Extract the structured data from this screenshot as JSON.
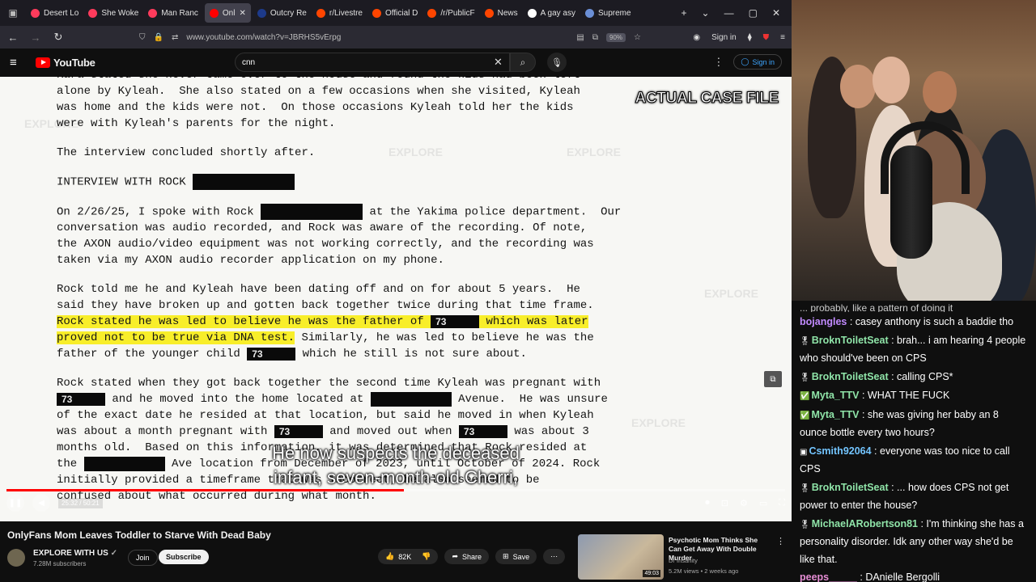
{
  "browser": {
    "tabs": [
      {
        "label": "Desert Lo",
        "color": "#ff3b5c",
        "active": false
      },
      {
        "label": "She Woke",
        "color": "#ff3b5c",
        "active": false
      },
      {
        "label": "Man Ranc",
        "color": "#ff3b5c",
        "active": false
      },
      {
        "label": "Onl",
        "color": "#ff0000",
        "active": true
      },
      {
        "label": "Outcry Re",
        "color": "#1d3a8a",
        "active": false
      },
      {
        "label": "r/Livestre",
        "color": "#ff4500",
        "active": false
      },
      {
        "label": "Official D",
        "color": "#ff4500",
        "active": false
      },
      {
        "label": "/r/PublicF",
        "color": "#ff4500",
        "active": false
      },
      {
        "label": "News",
        "color": "#ff4500",
        "active": false
      },
      {
        "label": "A gay asy",
        "color": "#ffffff",
        "active": false
      },
      {
        "label": "Supreme",
        "color": "#6b8fd6",
        "active": false
      }
    ],
    "url": "www.youtube.com/watch?v=JBRHS5vErpg",
    "zoom": "90%",
    "signin": "Sign in",
    "badge_count": "300"
  },
  "youtube": {
    "logo_text": "YouTube",
    "search_value": "cnn",
    "signin": "Sign in"
  },
  "video": {
    "overlay_label": "ACTUAL CASE FILE",
    "doc": {
      "p0": "Kara stated she never came over to the house and found the kids had been left",
      "p1": "alone by Kyleah.  She also stated on a few occasions when she visited, Kyleah",
      "p2": "was home and the kids were not.  On those occasions Kyleah told her the kids",
      "p3": "were with Kyleah's parents for the night.",
      "p4": "The interview concluded shortly after.",
      "p5": "INTERVIEW WITH ROCK",
      "p6a": "On 2/26/25, I spoke with Rock",
      "p6b": "at the Yakima police department.  Our",
      "p7": "conversation was audio recorded, and Rock was aware of the recording. Of note,",
      "p8": "the AXON audio/video equipment was not working correctly, and the recording was",
      "p9": "taken via my AXON audio recorder application on my phone.",
      "p10": "Rock told me he and Kyleah have been dating off and on for about 5 years.  He",
      "p11": "said they have broken up and gotten back together twice during that time frame.",
      "p12a": "Rock stated he was led to believe he was the father of",
      "p12b": "which was later",
      "p13a": "proved not to be true via DNA test.",
      "p13b": " Similarly, he was led to believe he was the",
      "p14a": "father of the younger child",
      "p14b": "which he still is not sure about.",
      "p15": "Rock stated when they got back together the second time Kyleah was pregnant with",
      "p16a": "and he moved into the home located at",
      "p16b": "Avenue.  He was unsure",
      "p17": "of the exact date he resided at that location, but said he moved in when Kyleah",
      "p18a": "was about a month pregnant with",
      "p18b": "and moved out when",
      "p18c": "was about 3",
      "p19": "months old.  Based on this information, it was determined that Rock resided at",
      "p20a": "the",
      "p20b": "Ave location from December of 2023, until October of 2024. Rock",
      "p21": "initially provided a timeframe that was incorrect, he also seemed to be",
      "p22": "confused about what occurred during what month.",
      "redact_num": "73"
    },
    "subtitle_line1": "He now suspects the deceased",
    "subtitle_line2": "infant, seven-month-old Cherri,",
    "timecode": "25:32 / 50:21",
    "progress": 0.51
  },
  "below": {
    "title": "OnlyFans Mom Leaves Toddler to Starve With Dead Baby",
    "channel": "EXPLORE WITH US",
    "subs": "7.28M subscribers",
    "join": "Join",
    "subscribe": "Subscribe",
    "likes": "82K",
    "share": "Share",
    "save": "Save",
    "rec": {
      "title": "Psychotic Mom Thinks She Can Get Away With Double Murder",
      "channel": "Dr Insanity",
      "meta": "5.2M views • 2 weeks ago",
      "duration": "49:03"
    }
  },
  "chat": {
    "clip": "... probably, like a pattern of doing it",
    "messages": [
      {
        "user": "bojangles",
        "text": "casey anthony is such a baddie tho",
        "badge": "",
        "color": "purple"
      },
      {
        "user": "BroknToiletSeat",
        "text": "brah... i am hearing 4 people who should've been on CPS",
        "badge": "🎖",
        "color": "green"
      },
      {
        "user": "BroknToiletSeat",
        "text": "calling CPS*",
        "badge": "🎖",
        "color": "green"
      },
      {
        "user": "Myta_TTV",
        "text": "WHAT THE FUCK",
        "badge": "✅",
        "color": "green"
      },
      {
        "user": "Myta_TTV",
        "text": "she was giving her baby an 8 ounce bottle every two hours?",
        "badge": "✅",
        "color": "green"
      },
      {
        "user": "Csmith92064",
        "text": "everyone was too nice to call CPS",
        "badge": "▣",
        "color": "blue"
      },
      {
        "user": "BroknToiletSeat",
        "text": "... how does CPS not get power to enter the house?",
        "badge": "🎖",
        "color": "green"
      },
      {
        "user": "MichaelARobertson81",
        "text": "I'm thinking she has a personality disorder. Idk any other way she'd be like that.",
        "badge": "🎖",
        "color": "green"
      },
      {
        "user": "peeps_____",
        "text": "DAnielle Bergolli",
        "badge": "",
        "color": "pink"
      }
    ]
  }
}
